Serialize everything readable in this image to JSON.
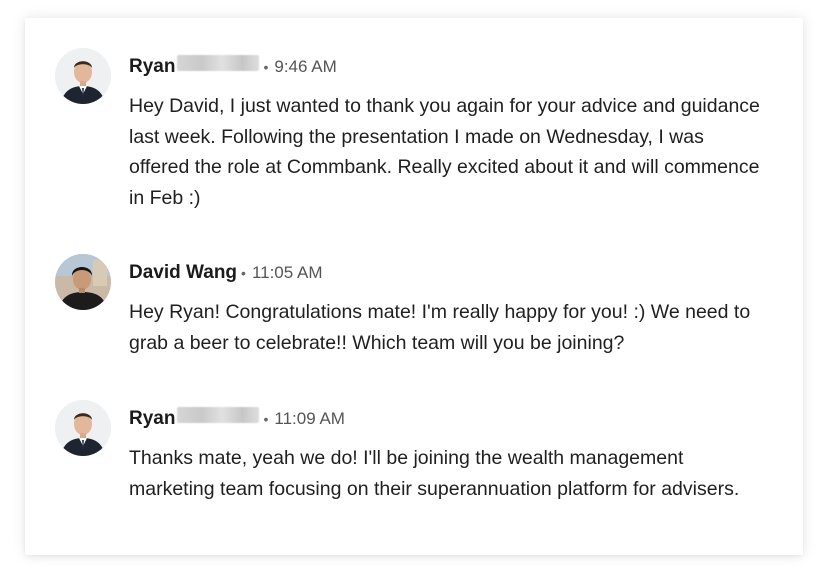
{
  "messages": [
    {
      "sender": "Ryan",
      "surname_redacted": true,
      "separator": "•",
      "time": "9:46 AM",
      "text": "Hey David, I just wanted to thank you again for your advice and guidance last week. Following the presentation I made on Wednesday, I was offered the role at Commbank. Really excited about it and will commence in Feb :)",
      "avatar_icon": "person-photo-avatar"
    },
    {
      "sender": "David Wang",
      "surname_redacted": false,
      "separator": "•",
      "time": "11:05 AM",
      "text": "Hey Ryan! Congratulations mate! I'm really happy for you! :) We need to grab a beer to celebrate!! Which team will you be joining?",
      "avatar_icon": "person-photo-avatar"
    },
    {
      "sender": "Ryan",
      "surname_redacted": true,
      "separator": "•",
      "time": "11:09 AM",
      "text": "Thanks mate, yeah we do! I'll be joining the wealth management marketing team focusing on their superannuation platform for advisers.",
      "avatar_icon": "person-photo-avatar"
    }
  ],
  "colors": {
    "background": "#ffffff",
    "name_text": "#1b1b1b",
    "body_text": "#1f1f1f",
    "meta_text": "#555555",
    "redaction_blur": "#cfcfcf"
  }
}
